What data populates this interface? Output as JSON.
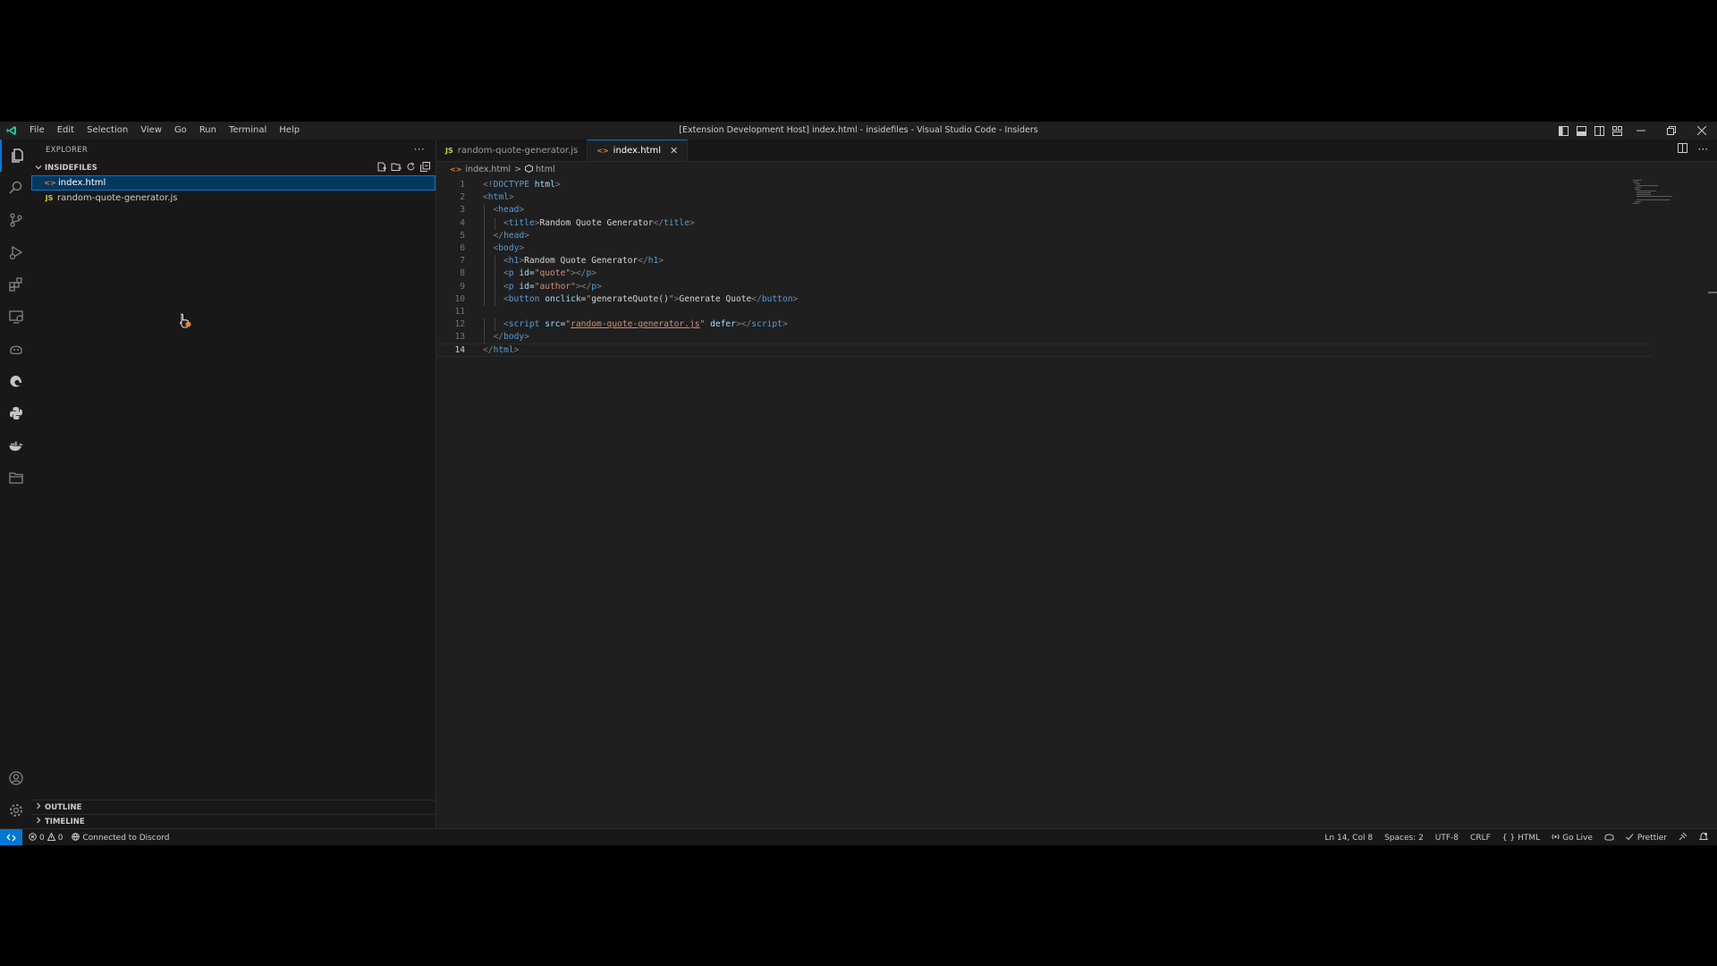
{
  "titlebar": {
    "menu": [
      "File",
      "Edit",
      "Selection",
      "View",
      "Go",
      "Run",
      "Terminal",
      "Help"
    ],
    "window_title": "[Extension Development Host] index.html - insidefiles - Visual Studio Code - Insiders"
  },
  "sidebar": {
    "title": "EXPLORER",
    "folder": "INSIDEFILES",
    "files": [
      {
        "icon": "html",
        "icon_glyph": "<>",
        "name": "index.html",
        "selected": true
      },
      {
        "icon": "js",
        "icon_glyph": "JS",
        "name": "random-quote-generator.js",
        "selected": false
      }
    ],
    "outline": "OUTLINE",
    "timeline": "TIMELINE"
  },
  "editor": {
    "tabs": [
      {
        "icon_glyph": "JS",
        "label": "random-quote-generator.js",
        "active": false
      },
      {
        "icon_glyph": "<>",
        "label": "index.html",
        "active": true,
        "close": "✕"
      }
    ],
    "breadcrumb": {
      "file": "index.html",
      "separator": ">",
      "symbol": "html"
    },
    "lines": [
      {
        "n": "1",
        "indent": 0,
        "tokens": [
          [
            "br",
            "<!"
          ],
          [
            "tag",
            "DOCTYPE "
          ],
          [
            "attr",
            "html"
          ],
          [
            "br",
            ">"
          ]
        ]
      },
      {
        "n": "2",
        "indent": 0,
        "tokens": [
          [
            "br",
            "<"
          ],
          [
            "tag",
            "html"
          ],
          [
            "br",
            ">"
          ]
        ]
      },
      {
        "n": "3",
        "indent": 1,
        "tokens": [
          [
            "br",
            "<"
          ],
          [
            "tag",
            "head"
          ],
          [
            "br",
            ">"
          ]
        ]
      },
      {
        "n": "4",
        "indent": 2,
        "tokens": [
          [
            "br",
            "<"
          ],
          [
            "tag",
            "title"
          ],
          [
            "br",
            ">"
          ],
          [
            "tx",
            "Random Quote Generator"
          ],
          [
            "br",
            "</"
          ],
          [
            "tag",
            "title"
          ],
          [
            "br",
            ">"
          ]
        ]
      },
      {
        "n": "5",
        "indent": 1,
        "tokens": [
          [
            "br",
            "</"
          ],
          [
            "tag",
            "head"
          ],
          [
            "br",
            ">"
          ]
        ]
      },
      {
        "n": "6",
        "indent": 1,
        "tokens": [
          [
            "br",
            "<"
          ],
          [
            "tag",
            "body"
          ],
          [
            "br",
            ">"
          ]
        ]
      },
      {
        "n": "7",
        "indent": 2,
        "tokens": [
          [
            "br",
            "<"
          ],
          [
            "tag",
            "h1"
          ],
          [
            "br",
            ">"
          ],
          [
            "tx",
            "Random Quote Generator"
          ],
          [
            "br",
            "</"
          ],
          [
            "tag",
            "h1"
          ],
          [
            "br",
            ">"
          ]
        ]
      },
      {
        "n": "8",
        "indent": 2,
        "tokens": [
          [
            "br",
            "<"
          ],
          [
            "tag",
            "p "
          ],
          [
            "attr",
            "id"
          ],
          [
            "tx",
            "="
          ],
          [
            "str",
            "\"quote\""
          ],
          [
            "br",
            "></"
          ],
          [
            "tag",
            "p"
          ],
          [
            "br",
            ">"
          ]
        ]
      },
      {
        "n": "9",
        "indent": 2,
        "tokens": [
          [
            "br",
            "<"
          ],
          [
            "tag",
            "p "
          ],
          [
            "attr",
            "id"
          ],
          [
            "tx",
            "="
          ],
          [
            "str",
            "\"author\""
          ],
          [
            "br",
            "></"
          ],
          [
            "tag",
            "p"
          ],
          [
            "br",
            ">"
          ]
        ]
      },
      {
        "n": "10",
        "indent": 2,
        "tokens": [
          [
            "br",
            "<"
          ],
          [
            "tag",
            "button "
          ],
          [
            "attr",
            "onclick"
          ],
          [
            "tx",
            "="
          ],
          [
            "str",
            "\""
          ],
          [
            "tx",
            "generateQuote()"
          ],
          [
            "str",
            "\""
          ],
          [
            "br",
            ">"
          ],
          [
            "tx",
            "Generate Quote"
          ],
          [
            "br",
            "</"
          ],
          [
            "tag",
            "button"
          ],
          [
            "br",
            ">"
          ]
        ]
      },
      {
        "n": "11",
        "indent": 0,
        "tokens": []
      },
      {
        "n": "12",
        "indent": 2,
        "tokens": [
          [
            "br",
            "<"
          ],
          [
            "tag",
            "script "
          ],
          [
            "attr",
            "src"
          ],
          [
            "tx",
            "="
          ],
          [
            "str",
            "\""
          ],
          [
            "link",
            "random-quote-generator.js"
          ],
          [
            "str",
            "\" "
          ],
          [
            "attr",
            "defer"
          ],
          [
            "br",
            "></"
          ],
          [
            "tag",
            "script"
          ],
          [
            "br",
            ">"
          ]
        ]
      },
      {
        "n": "13",
        "indent": 1,
        "tokens": [
          [
            "br",
            "</"
          ],
          [
            "tag",
            "body"
          ],
          [
            "br",
            ">"
          ]
        ]
      },
      {
        "n": "14",
        "indent": 0,
        "current": true,
        "tokens": [
          [
            "br",
            "</"
          ],
          [
            "tag",
            "html"
          ],
          [
            "br",
            ">"
          ]
        ]
      }
    ]
  },
  "statusbar": {
    "errors": "0",
    "warnings": "0",
    "discord": "Connected to Discord",
    "position": "Ln 14, Col 8",
    "spaces": "Spaces: 2",
    "encoding": "UTF-8",
    "eol": "CRLF",
    "language": "HTML",
    "golive": "Go Live",
    "prettier": "Prettier"
  },
  "colors": {
    "accent": "#0078d4",
    "background": "#1f1f1f",
    "sidebar": "#181818"
  }
}
